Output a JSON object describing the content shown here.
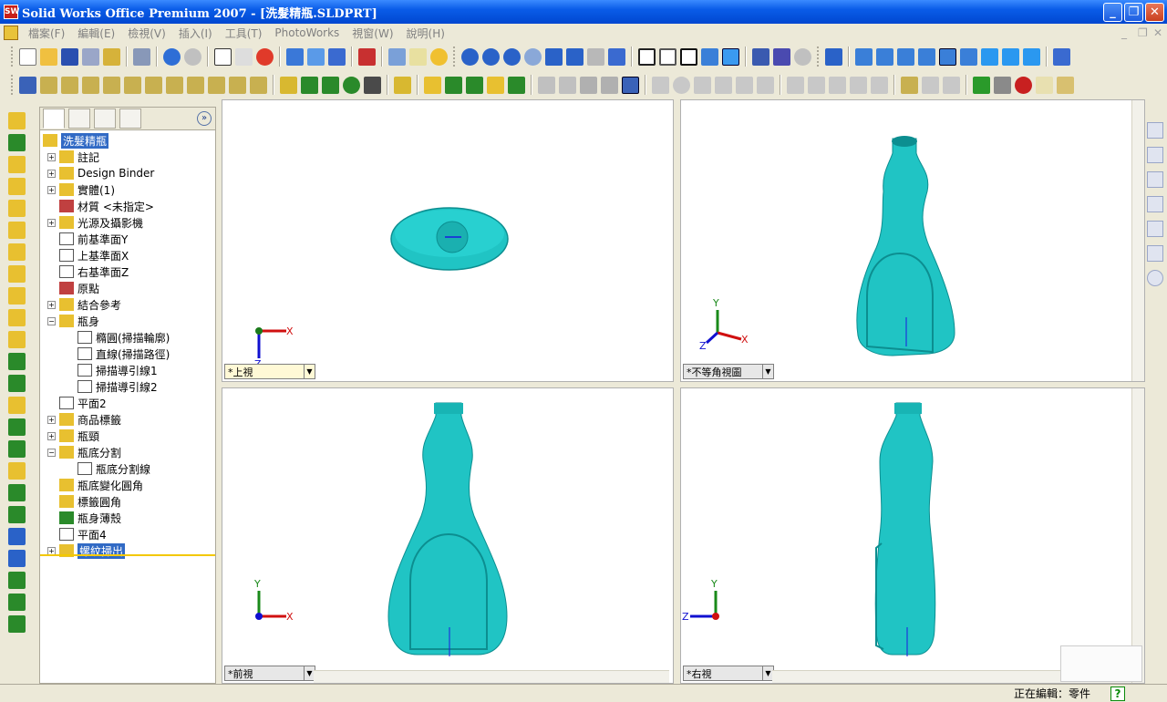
{
  "window": {
    "app_icon_text": "SW",
    "title": "Solid Works Office Premium 2007 - [洗髮精瓶.SLDPRT]",
    "minimize": "_",
    "maximize": "❐",
    "close": "✕"
  },
  "menu": {
    "items": [
      "檔案(F)",
      "編輯(E)",
      "檢視(V)",
      "插入(I)",
      "工具(T)",
      "PhotoWorks",
      "視窗(W)",
      "說明(H)"
    ],
    "mdi_controls": [
      "_",
      "❐",
      "✕"
    ]
  },
  "feature_tree": {
    "root": "洗髮精瓶",
    "collapse_label": "»",
    "nodes": [
      {
        "label": "註記",
        "expander": "+",
        "icon": "annotation-icon"
      },
      {
        "label": "Design Binder",
        "expander": "+",
        "icon": "design-binder-icon"
      },
      {
        "label": "實體(1)",
        "expander": "+",
        "icon": "solid-bodies-icon"
      },
      {
        "label": "材質 <未指定>",
        "expander": "",
        "icon": "material-icon"
      },
      {
        "label": "光源及攝影機",
        "expander": "+",
        "icon": "lights-cameras-icon"
      },
      {
        "label": "前基準面Y",
        "expander": "",
        "icon": "plane-icon"
      },
      {
        "label": "上基準面X",
        "expander": "",
        "icon": "plane-icon"
      },
      {
        "label": "右基準面Z",
        "expander": "",
        "icon": "plane-icon"
      },
      {
        "label": "原點",
        "expander": "",
        "icon": "origin-icon"
      },
      {
        "label": "結合參考",
        "expander": "+",
        "icon": "mate-reference-icon"
      },
      {
        "label": "瓶身",
        "expander": "−",
        "icon": "sweep-feature-icon"
      },
      {
        "label": "橢圓(掃描輪廓)",
        "expander": "",
        "icon": "sketch-icon",
        "indent": 1
      },
      {
        "label": "直線(掃描路徑)",
        "expander": "",
        "icon": "sketch-icon",
        "indent": 1
      },
      {
        "label": "掃描導引線1",
        "expander": "",
        "icon": "guide-curve-icon",
        "indent": 1
      },
      {
        "label": "掃描導引線2",
        "expander": "",
        "icon": "guide-curve-icon",
        "indent": 1
      },
      {
        "label": "平面2",
        "expander": "",
        "icon": "plane-icon"
      },
      {
        "label": "商品標籤",
        "expander": "+",
        "icon": "sweep-feature-icon"
      },
      {
        "label": "瓶頸",
        "expander": "+",
        "icon": "extrude-feature-icon"
      },
      {
        "label": "瓶底分割",
        "expander": "−",
        "icon": "split-line-icon"
      },
      {
        "label": "瓶底分割線",
        "expander": "",
        "icon": "sketch-icon",
        "indent": 1
      },
      {
        "label": "瓶底變化圓角",
        "expander": "",
        "icon": "fillet-icon"
      },
      {
        "label": "標籤圓角",
        "expander": "",
        "icon": "fillet-icon"
      },
      {
        "label": "瓶身薄殼",
        "expander": "",
        "icon": "shell-icon"
      },
      {
        "label": "平面4",
        "expander": "",
        "icon": "plane-icon"
      },
      {
        "label": "螺紋掃出",
        "expander": "+",
        "icon": "sweep-feature-icon",
        "selected": true
      }
    ]
  },
  "viewports": [
    {
      "label": "*上視",
      "dropdown": "▼",
      "triad": {
        "x": "X",
        "z": "Z"
      }
    },
    {
      "label": "*不等角視圖",
      "dropdown": "▼",
      "triad": {
        "x": "X",
        "y": "Y",
        "z": "Z"
      }
    },
    {
      "label": "*前視",
      "dropdown": "▼",
      "triad": {
        "x": "X",
        "y": "Y"
      }
    },
    {
      "label": "*右視",
      "dropdown": "▼",
      "triad": {
        "y": "Y",
        "z": "Z"
      }
    }
  ],
  "status": {
    "text": "正在編輯：零件",
    "help": "?"
  },
  "colors": {
    "model": "#20c4c4",
    "model_shade": "#0c8e90",
    "titlebar": "#0a5ce8",
    "selected": "#316ac5"
  }
}
